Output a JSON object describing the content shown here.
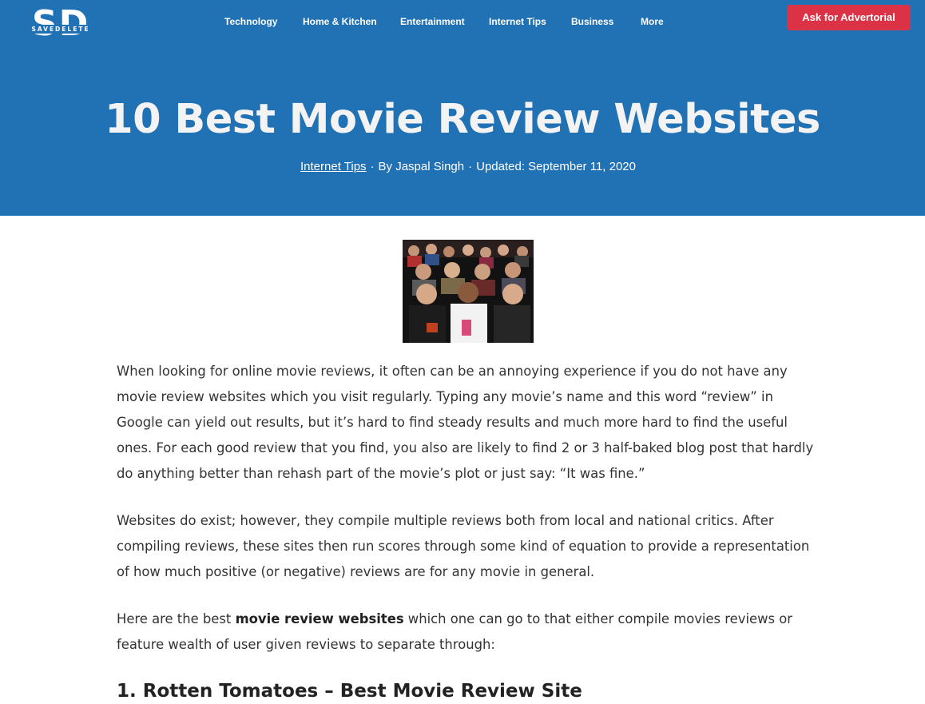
{
  "site": {
    "logo_letters": "SD",
    "logo_tagline": "SAVEDELETE"
  },
  "nav": {
    "items": [
      "Technology",
      "Home & Kitchen",
      "Entertainment",
      "Internet Tips",
      "Business",
      "More"
    ],
    "cta_label": "Ask for Advertorial"
  },
  "colors": {
    "hero_background": "#2171b5",
    "cta_background": "#dc3245",
    "text": "#333333"
  },
  "article": {
    "title": "10 Best Movie Review Websites",
    "meta": {
      "category": "Internet Tips",
      "author": "By Jaspal Singh",
      "updated": "Updated: September 11, 2020"
    },
    "paragraphs": [
      "When looking for online movie reviews, it often can be an annoying experience if you do not have any movie review websites which you visit regularly. Typing any movie’s name and this word “review” in Google can yield out results, but it’s hard to find steady results and much more hard to find the useful ones. For each good review that you find, you also are likely to find 2 or 3 half-baked blog post that hardly do anything better than rehash part of the movie’s plot or just say: “It was fine.”",
      "Websites do exist; however, they compile multiple reviews both from local and national critics. After compiling reviews, these sites then run scores through some kind of equation to provide a representation of how much positive (or negative) reviews are for any movie in general."
    ],
    "intro": {
      "before": "Here are the best ",
      "bold": "movie review websites",
      "after": " which one can go to that either compile movies reviews or feature wealth of user given reviews to separate through:"
    },
    "first_heading": "1. Rotten Tomatoes – Best Movie Review Site"
  }
}
